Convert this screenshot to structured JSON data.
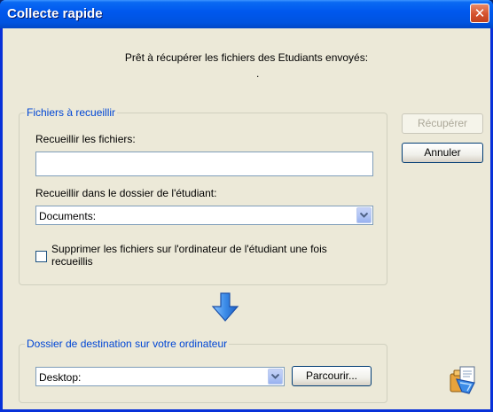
{
  "window": {
    "title": "Collecte rapide",
    "close_symbol": "✕"
  },
  "status": {
    "message": "Prêt à récupérer les fichiers des Etudiants envoyés:",
    "detail": "."
  },
  "collect_group": {
    "legend": "Fichiers à recueillir",
    "files_label": "Recueillir les fichiers:",
    "files_value": "",
    "folder_label": "Recueillir dans le dossier de l'étudiant:",
    "folder_value": "Documents:",
    "delete_label": "Supprimer les fichiers sur l'ordinateur de l'étudiant une fois recueillis",
    "delete_checked": false
  },
  "destination_group": {
    "legend": "Dossier de destination sur votre ordinateur",
    "folder_value": "Desktop:",
    "browse_label": "Parcourir..."
  },
  "buttons": {
    "retrieve_label": "Récupérer",
    "cancel_label": "Annuler"
  },
  "icons": {
    "transfer_arrow": "arrow-down-icon",
    "app": "collect-app-icon",
    "accent": "#3c8ce8"
  }
}
